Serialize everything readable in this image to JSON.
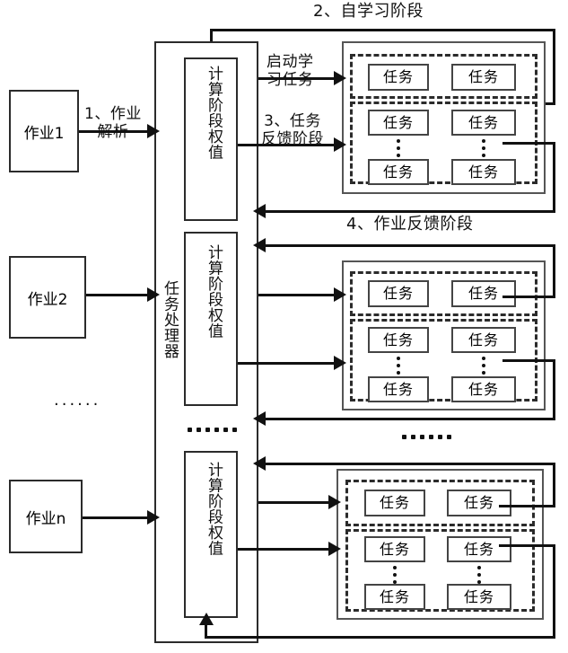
{
  "diagram": {
    "title_phase2": "2、自学习阶段",
    "title_phase4": "4、作业反馈阶段",
    "jobs": [
      {
        "label": "作业1"
      },
      {
        "label": "作业2"
      },
      {
        "label": "作业n"
      }
    ],
    "jobs_ellipsis": "......",
    "processor": {
      "label": "任务处理器"
    },
    "weight_units": [
      {
        "label": "计算阶段权值"
      },
      {
        "label": "计算阶段权值"
      },
      {
        "label": "计算阶段权值"
      }
    ],
    "processor_ellipsis": "......",
    "groups_ellipsis": "......",
    "edge_labels": {
      "job_parse": "1、作业\n解析",
      "start_learning": "启动学\n习任务",
      "task_feedback": "3、任务\n反馈阶段"
    },
    "task_label": "任务",
    "task_groups": [
      {
        "top_row": [
          "任务",
          "任务"
        ],
        "bottom_rows": [
          [
            "任务",
            "任务"
          ],
          [
            "任务",
            "任务"
          ]
        ]
      },
      {
        "top_row": [
          "任务",
          "任务"
        ],
        "bottom_rows": [
          [
            "任务",
            "任务"
          ],
          [
            "任务",
            "任务"
          ]
        ]
      },
      {
        "top_row": [
          "任务",
          "任务"
        ],
        "bottom_rows": [
          [
            "任务",
            "任务"
          ],
          [
            "任务",
            "任务"
          ]
        ]
      }
    ],
    "colors": {
      "stroke": "#2b2b2b",
      "line": "#111111",
      "background": "#ffffff"
    }
  }
}
